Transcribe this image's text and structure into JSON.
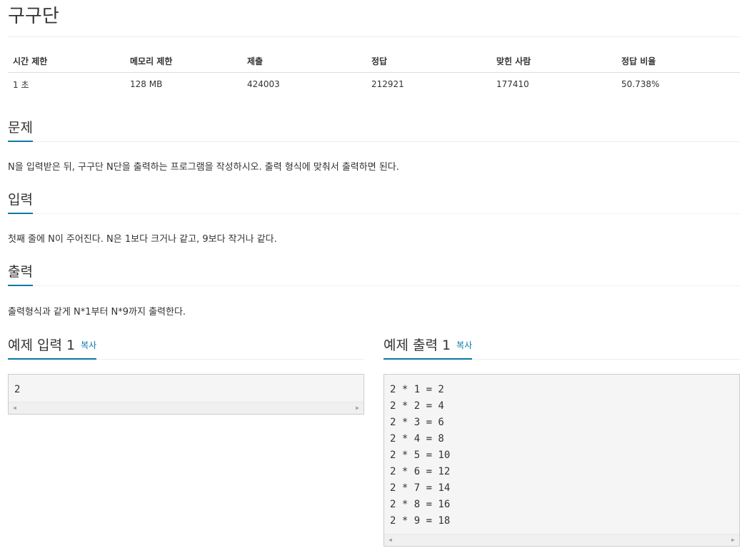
{
  "problem": {
    "title": "구구단"
  },
  "info_table": {
    "headers": [
      "시간 제한",
      "메모리 제한",
      "제출",
      "정답",
      "맞힌 사람",
      "정답 비율"
    ],
    "values": [
      "1 초",
      "128 MB",
      "424003",
      "212921",
      "177410",
      "50.738%"
    ]
  },
  "sections": {
    "description": {
      "heading": "문제",
      "text": "N을 입력받은 뒤, 구구단 N단을 출력하는 프로그램을 작성하시오. 출력 형식에 맞춰서 출력하면 된다."
    },
    "input": {
      "heading": "입력",
      "text": "첫째 줄에 N이 주어진다. N은 1보다 크거나 같고, 9보다 작거나 같다."
    },
    "output": {
      "heading": "출력",
      "text": "출력형식과 같게 N*1부터 N*9까지 출력한다."
    }
  },
  "samples": {
    "input": {
      "heading": "예제 입력 1",
      "copy_label": "복사",
      "content": "2"
    },
    "output": {
      "heading": "예제 출력 1",
      "copy_label": "복사",
      "content": "2 * 1 = 2\n2 * 2 = 4\n2 * 3 = 6\n2 * 4 = 8\n2 * 5 = 10\n2 * 6 = 12\n2 * 7 = 14\n2 * 8 = 16\n2 * 9 = 18"
    }
  },
  "colors": {
    "accent": "#0b79a6",
    "text": "#333333",
    "sample_bg": "#f5f5f5"
  },
  "icons": {
    "scroll_left": "scroll-left-arrow-icon",
    "scroll_right": "scroll-right-arrow-icon"
  }
}
